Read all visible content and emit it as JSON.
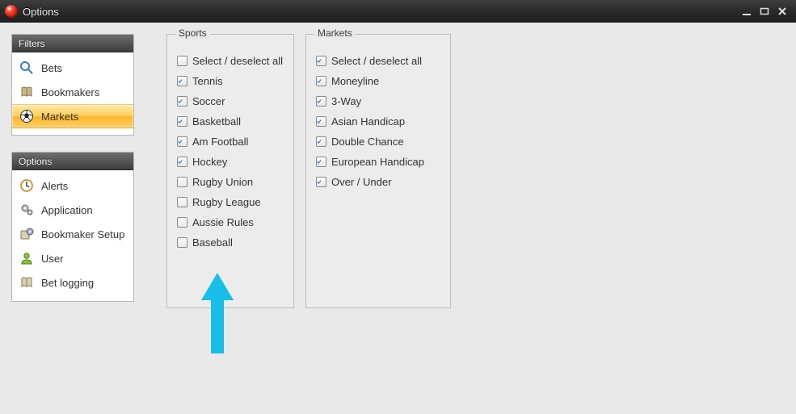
{
  "window": {
    "title": "Options"
  },
  "sidebar": {
    "sections": [
      {
        "header": "Filters",
        "items": [
          {
            "label": "Bets",
            "icon": "search"
          },
          {
            "label": "Bookmakers",
            "icon": "book"
          },
          {
            "label": "Markets",
            "icon": "soccer",
            "selected": true
          }
        ]
      },
      {
        "header": "Options",
        "items": [
          {
            "label": "Alerts",
            "icon": "clock"
          },
          {
            "label": "Application",
            "icon": "gears"
          },
          {
            "label": "Bookmaker Setup",
            "icon": "setup"
          },
          {
            "label": "User",
            "icon": "user"
          },
          {
            "label": "Bet logging",
            "icon": "booklog"
          }
        ]
      }
    ]
  },
  "groups": [
    {
      "title": "Sports",
      "items": [
        {
          "label": "Select / deselect all",
          "checked": false
        },
        {
          "label": "Tennis",
          "checked": true
        },
        {
          "label": "Soccer",
          "checked": true
        },
        {
          "label": "Basketball",
          "checked": true
        },
        {
          "label": "Am Football",
          "checked": true
        },
        {
          "label": "Hockey",
          "checked": true
        },
        {
          "label": "Rugby Union",
          "checked": false
        },
        {
          "label": "Rugby League",
          "checked": false
        },
        {
          "label": "Aussie Rules",
          "checked": false
        },
        {
          "label": "Baseball",
          "checked": false
        }
      ]
    },
    {
      "title": "Markets",
      "items": [
        {
          "label": "Select / deselect all",
          "checked": true
        },
        {
          "label": "Moneyline",
          "checked": true
        },
        {
          "label": "3-Way",
          "checked": true
        },
        {
          "label": "Asian Handicap",
          "checked": true
        },
        {
          "label": "Double Chance",
          "checked": true
        },
        {
          "label": "European Handicap",
          "checked": true
        },
        {
          "label": "Over / Under",
          "checked": true
        }
      ]
    }
  ]
}
